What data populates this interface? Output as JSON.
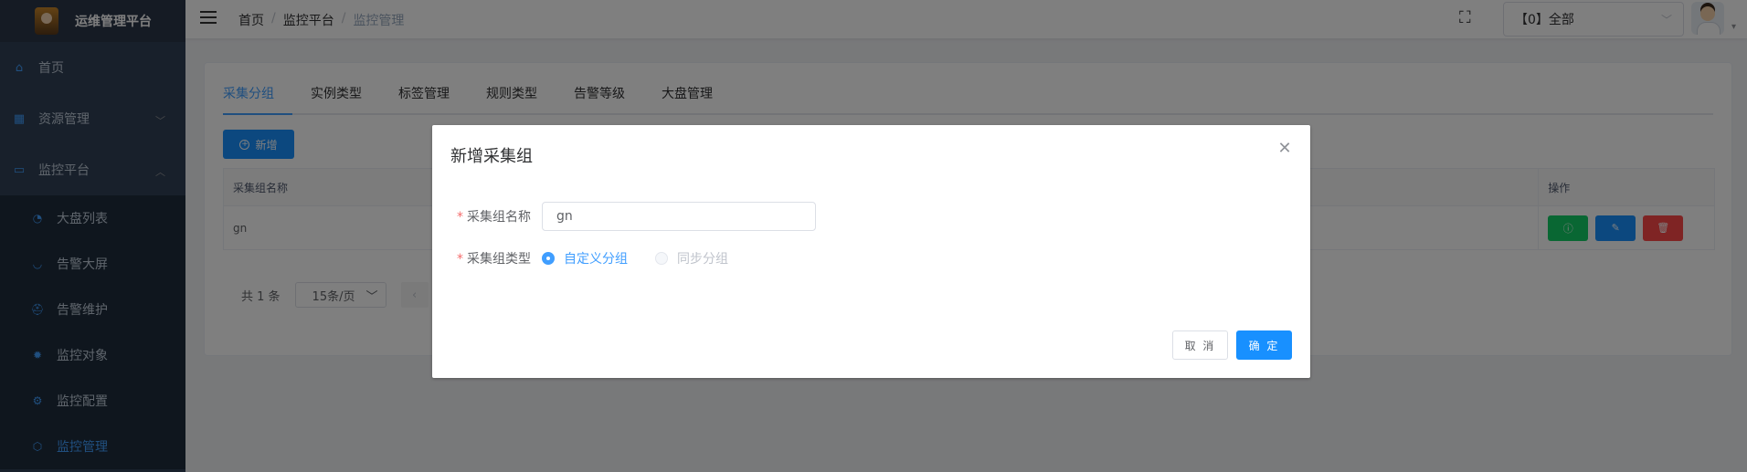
{
  "app": {
    "title": "运维管理平台"
  },
  "sidebar": {
    "items": [
      {
        "label": "首页",
        "icon": "home-icon"
      },
      {
        "label": "资源管理",
        "icon": "server-icon"
      },
      {
        "label": "监控平台",
        "icon": "monitor-icon"
      }
    ],
    "submenu": [
      {
        "label": "大盘列表",
        "icon": "dashboard-icon"
      },
      {
        "label": "告警大屏",
        "icon": "screen-icon"
      },
      {
        "label": "告警维护",
        "icon": "maintenance-icon"
      },
      {
        "label": "监控对象",
        "icon": "target-icon"
      },
      {
        "label": "监控配置",
        "icon": "config-icon"
      },
      {
        "label": "监控管理",
        "icon": "manage-icon"
      }
    ]
  },
  "header": {
    "breadcrumb": [
      "首页",
      "监控平台",
      "监控管理"
    ],
    "tenant": "【0】全部"
  },
  "tabs": [
    "采集分组",
    "实例类型",
    "标签管理",
    "规则类型",
    "告警等级",
    "大盘管理"
  ],
  "toolbar": {
    "add_label": "新增"
  },
  "table": {
    "columns": [
      "采集组名称",
      "操作"
    ],
    "rows": [
      {
        "name": "gn"
      }
    ]
  },
  "pagination": {
    "total": "共 1 条",
    "page_size": "15条/页"
  },
  "dialog": {
    "title": "新增采集组",
    "name_label": "采集组名称",
    "name_value": "gn",
    "type_label": "采集组类型",
    "type_options": [
      "自定义分组",
      "同步分组"
    ],
    "cancel": "取 消",
    "confirm": "确 定"
  },
  "colors": {
    "accent": "#409eff",
    "sidebar": "#304156",
    "primary_btn": "#1890ff"
  }
}
